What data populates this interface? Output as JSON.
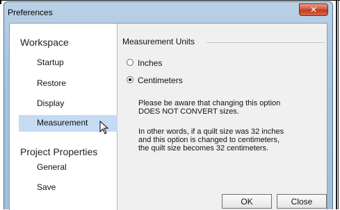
{
  "window": {
    "title": "Preferences"
  },
  "sidebar": {
    "sections": [
      {
        "label": "Workspace",
        "items": [
          "Startup",
          "Restore",
          "Display",
          "Measurement"
        ]
      },
      {
        "label": "Project Properties",
        "items": [
          "General",
          "Save"
        ]
      }
    ],
    "selected": "Measurement"
  },
  "main": {
    "group_label": "Measurement Units",
    "options": [
      {
        "label": "Inches",
        "checked": false
      },
      {
        "label": "Centimeters",
        "checked": true
      }
    ],
    "note1_line1": "Please be aware that changing this option",
    "note1_line2": "DOES NOT CONVERT sizes.",
    "note2_line1": "In other words, if a quilt size was 32 inches",
    "note2_line2": "and this option is changed to centimeters,",
    "note2_line3": "the quilt size becomes 32 centimeters."
  },
  "buttons": {
    "ok": "OK",
    "close": "Close"
  },
  "icons": {
    "close": "close-icon",
    "cursor": "mouse-pointer-icon"
  },
  "colors": {
    "selected_bg": "#c5daf3",
    "close_red": "#c0391e"
  }
}
